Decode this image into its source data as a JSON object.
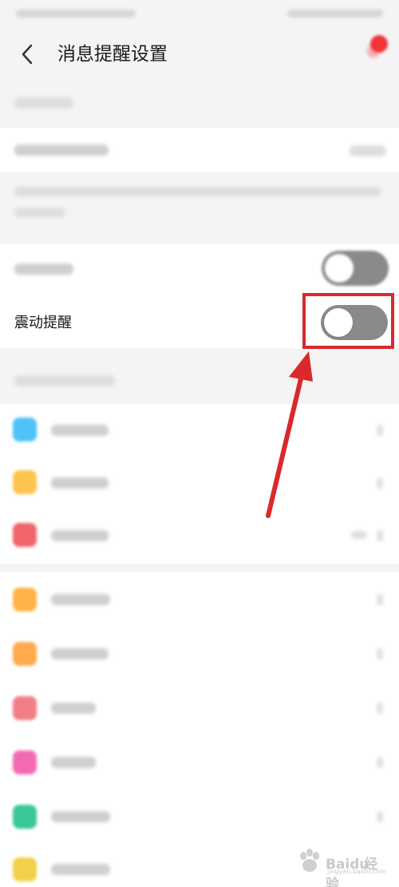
{
  "header": {
    "title": "消息提醒设置"
  },
  "settings": {
    "vibration_label": "震动提醒",
    "vibration_on": false
  },
  "watermark": {
    "brand": "Bai",
    "brand_tail": "经验",
    "url": "jingyan.baidu.com"
  },
  "colors": {
    "highlight": "#d9292b",
    "toggle_track": "#8a8a8a",
    "badge": "#f0343a",
    "icon_colors": [
      "#4ec3f7",
      "#ffc44d",
      "#f1656a",
      "#ffb347",
      "#ffaa4c",
      "#ef7f84",
      "#f26bb2",
      "#39c795",
      "#f2d04a"
    ]
  }
}
